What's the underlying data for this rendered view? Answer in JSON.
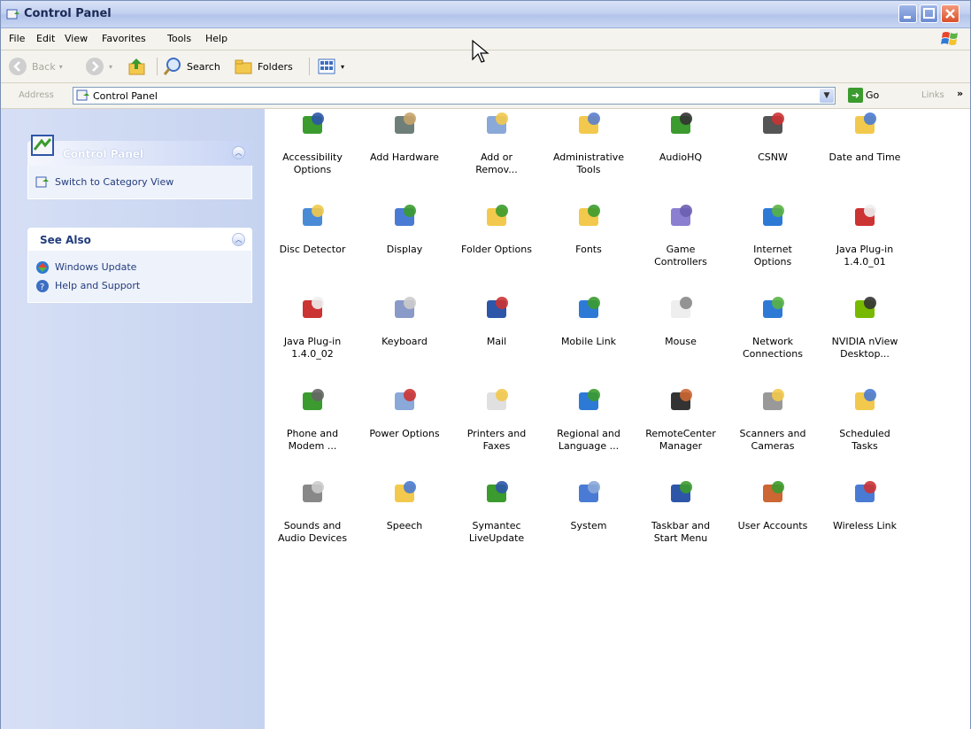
{
  "window": {
    "title": "Control Panel"
  },
  "menu": [
    "File",
    "Edit",
    "View",
    "Favorites",
    "Tools",
    "Help"
  ],
  "toolbar": {
    "back": "Back",
    "search": "Search",
    "folders": "Folders"
  },
  "address": {
    "label": "Address",
    "value": "Control Panel",
    "go": "Go",
    "links": "Links"
  },
  "taskpane": {
    "control_panel": {
      "title": "Control Panel",
      "switch": "Switch to Category View"
    },
    "see_also": {
      "title": "See Also",
      "items": [
        "Windows Update",
        "Help and Support"
      ]
    }
  },
  "icons": [
    {
      "label": "Accessibility\nOptions",
      "icon": "accessibility-icon"
    },
    {
      "label": "Add Hardware",
      "icon": "add-hardware-icon"
    },
    {
      "label": "Add or\nRemov...",
      "icon": "add-remove-programs-icon"
    },
    {
      "label": "Administrative\nTools",
      "icon": "administrative-tools-icon"
    },
    {
      "label": "AudioHQ",
      "icon": "audiohq-icon"
    },
    {
      "label": "CSNW",
      "icon": "csnw-icon"
    },
    {
      "label": "Date and Time",
      "icon": "date-time-icon"
    },
    {
      "label": "Disc Detector",
      "icon": "disc-detector-icon"
    },
    {
      "label": "Display",
      "icon": "display-icon"
    },
    {
      "label": "Folder Options",
      "icon": "folder-options-icon"
    },
    {
      "label": "Fonts",
      "icon": "fonts-icon"
    },
    {
      "label": "Game\nControllers",
      "icon": "game-controllers-icon"
    },
    {
      "label": "Internet\nOptions",
      "icon": "internet-options-icon"
    },
    {
      "label": "Java Plug-in\n1.4.0_01",
      "icon": "java-plugin-icon"
    },
    {
      "label": "Java Plug-in\n1.4.0_02",
      "icon": "java-plugin-icon"
    },
    {
      "label": "Keyboard",
      "icon": "keyboard-icon"
    },
    {
      "label": "Mail",
      "icon": "mail-icon"
    },
    {
      "label": "Mobile Link",
      "icon": "mobile-link-icon"
    },
    {
      "label": "Mouse",
      "icon": "mouse-icon"
    },
    {
      "label": "Network\nConnections",
      "icon": "network-connections-icon"
    },
    {
      "label": "NVIDIA nView\nDesktop...",
      "icon": "nvidia-icon"
    },
    {
      "label": "Phone and\nModem ...",
      "icon": "phone-modem-icon"
    },
    {
      "label": "Power Options",
      "icon": "power-options-icon"
    },
    {
      "label": "Printers and\nFaxes",
      "icon": "printers-icon"
    },
    {
      "label": "Regional and\nLanguage ...",
      "icon": "regional-icon"
    },
    {
      "label": "RemoteCenter\nManager",
      "icon": "remotecenter-icon"
    },
    {
      "label": "Scanners and\nCameras",
      "icon": "scanners-icon"
    },
    {
      "label": "Scheduled\nTasks",
      "icon": "scheduled-tasks-icon"
    },
    {
      "label": "Sounds and\nAudio Devices",
      "icon": "sounds-icon"
    },
    {
      "label": "Speech",
      "icon": "speech-icon"
    },
    {
      "label": "Symantec\nLiveUpdate",
      "icon": "symantec-icon"
    },
    {
      "label": "System",
      "icon": "system-icon"
    },
    {
      "label": "Taskbar and\nStart Menu",
      "icon": "taskbar-icon"
    },
    {
      "label": "User Accounts",
      "icon": "user-accounts-icon"
    },
    {
      "label": "Wireless Link",
      "icon": "wireless-link-icon"
    }
  ]
}
